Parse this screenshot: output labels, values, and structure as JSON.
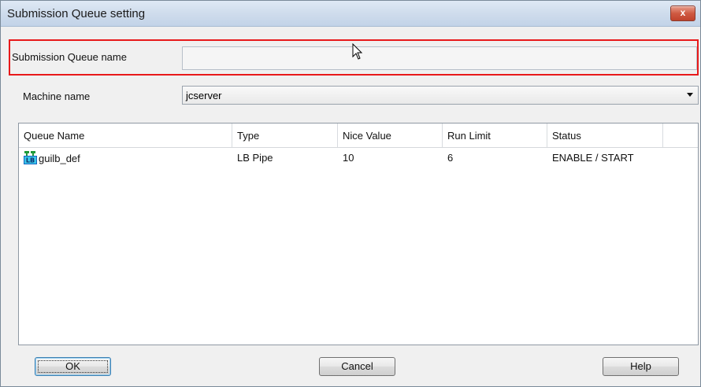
{
  "window": {
    "title": "Submission Queue setting",
    "close_symbol": "x"
  },
  "form": {
    "queue_name_label": "Submission Queue name",
    "queue_name_value": "",
    "machine_label": "Machine name",
    "machine_value": "jcserver"
  },
  "table": {
    "columns": [
      "Queue Name",
      "Type",
      "Nice Value",
      "Run Limit",
      "Status"
    ],
    "rows": [
      {
        "icon": "lb-queue-icon",
        "icon_text": "LB",
        "queue_name": "guilb_def",
        "type": "LB Pipe",
        "nice_value": "10",
        "run_limit": "6",
        "status": "ENABLE / START"
      }
    ]
  },
  "buttons": {
    "ok": "OK",
    "cancel": "Cancel",
    "help": "Help"
  },
  "colors": {
    "highlight": "#e8191a",
    "icon_green": "#1f9a3a",
    "icon_blue": "#1565c0"
  }
}
